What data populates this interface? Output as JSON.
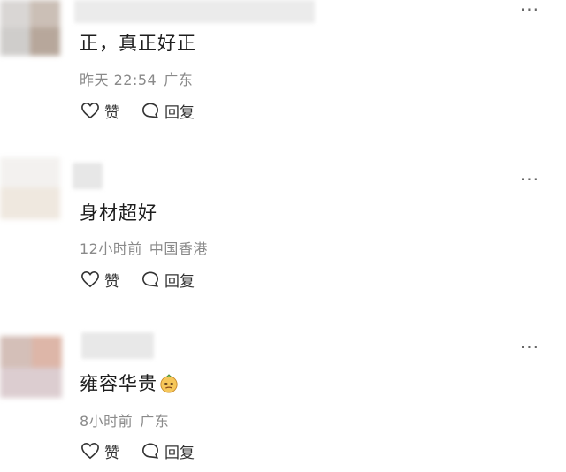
{
  "comments": [
    {
      "text": "正，真正好正",
      "time": "昨天 22:54",
      "location": "广东",
      "like_label": "赞",
      "reply_label": "回复",
      "more": "···"
    },
    {
      "text": "身材超好",
      "time": "12小时前",
      "location": "中国香港",
      "like_label": "赞",
      "reply_label": "回复",
      "more": "···"
    },
    {
      "text": "雍容华贵",
      "emoji": "face-emoji-icon",
      "time": "8小时前",
      "location": "广东",
      "like_label": "赞",
      "reply_label": "回复",
      "more": "···"
    }
  ]
}
